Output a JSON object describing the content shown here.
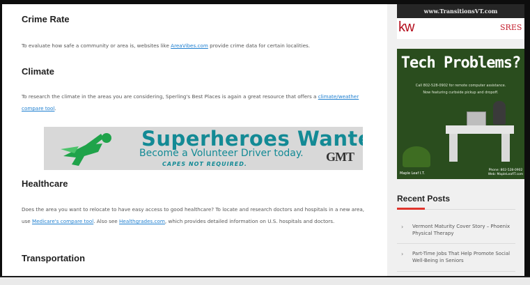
{
  "main": {
    "crime": {
      "heading": "Crime Rate",
      "text_before": "To evaluate how safe a community or area is, websites like ",
      "link": "AreaVibes.com",
      "text_after": " provide crime data for certain localities."
    },
    "climate": {
      "heading": "Climate",
      "text_before": "To research the climate in the areas you are considering, Sperling's Best Places is again a great resource that offers a ",
      "link": "climate/weather compare tool",
      "text_after": "."
    },
    "ad": {
      "title": "Superheroes Wanted!",
      "subtitle": "Become a Volunteer Driver today.",
      "tagline": "CAPES NOT REQUIRED.",
      "logo": "GMT",
      "accent_color": "#138a95"
    },
    "healthcare": {
      "heading": "Healthcare",
      "text_1": "Does the area you want to relocate to have easy access to good healthcare? To locate and research doctors and hospitals in a new area, use ",
      "link_1": "Medicare's compare tool",
      "text_2": ". Also see ",
      "link_2": "Healthgrades.com",
      "text_3": ", which provides detailed information on U.S. hospitals and doctors."
    },
    "transportation": {
      "heading": "Transportation"
    }
  },
  "sidebar": {
    "kw_ad": {
      "url": "www.TransitionsVT.com",
      "logo": "kw",
      "badge": "SRES",
      "brand_color": "#b40f1e"
    },
    "tech_ad": {
      "title": "Tech Problems?",
      "line1": "Call 802-528-0902 for remote computer assistance.",
      "line2": "Now featuring curbside pickup and dropoff.",
      "footer_left": "Maple Leaf I.T.",
      "footer_right": "Phone: 802-528-0902 Web: MapleLeafIT.com"
    },
    "recent_posts": {
      "title": "Recent Posts",
      "items": [
        "Vermont Maturity Cover Story – Phoenix Physical Therapy",
        "Part-Time Jobs That Help Promote Social Well-Being in Seniors"
      ]
    }
  }
}
